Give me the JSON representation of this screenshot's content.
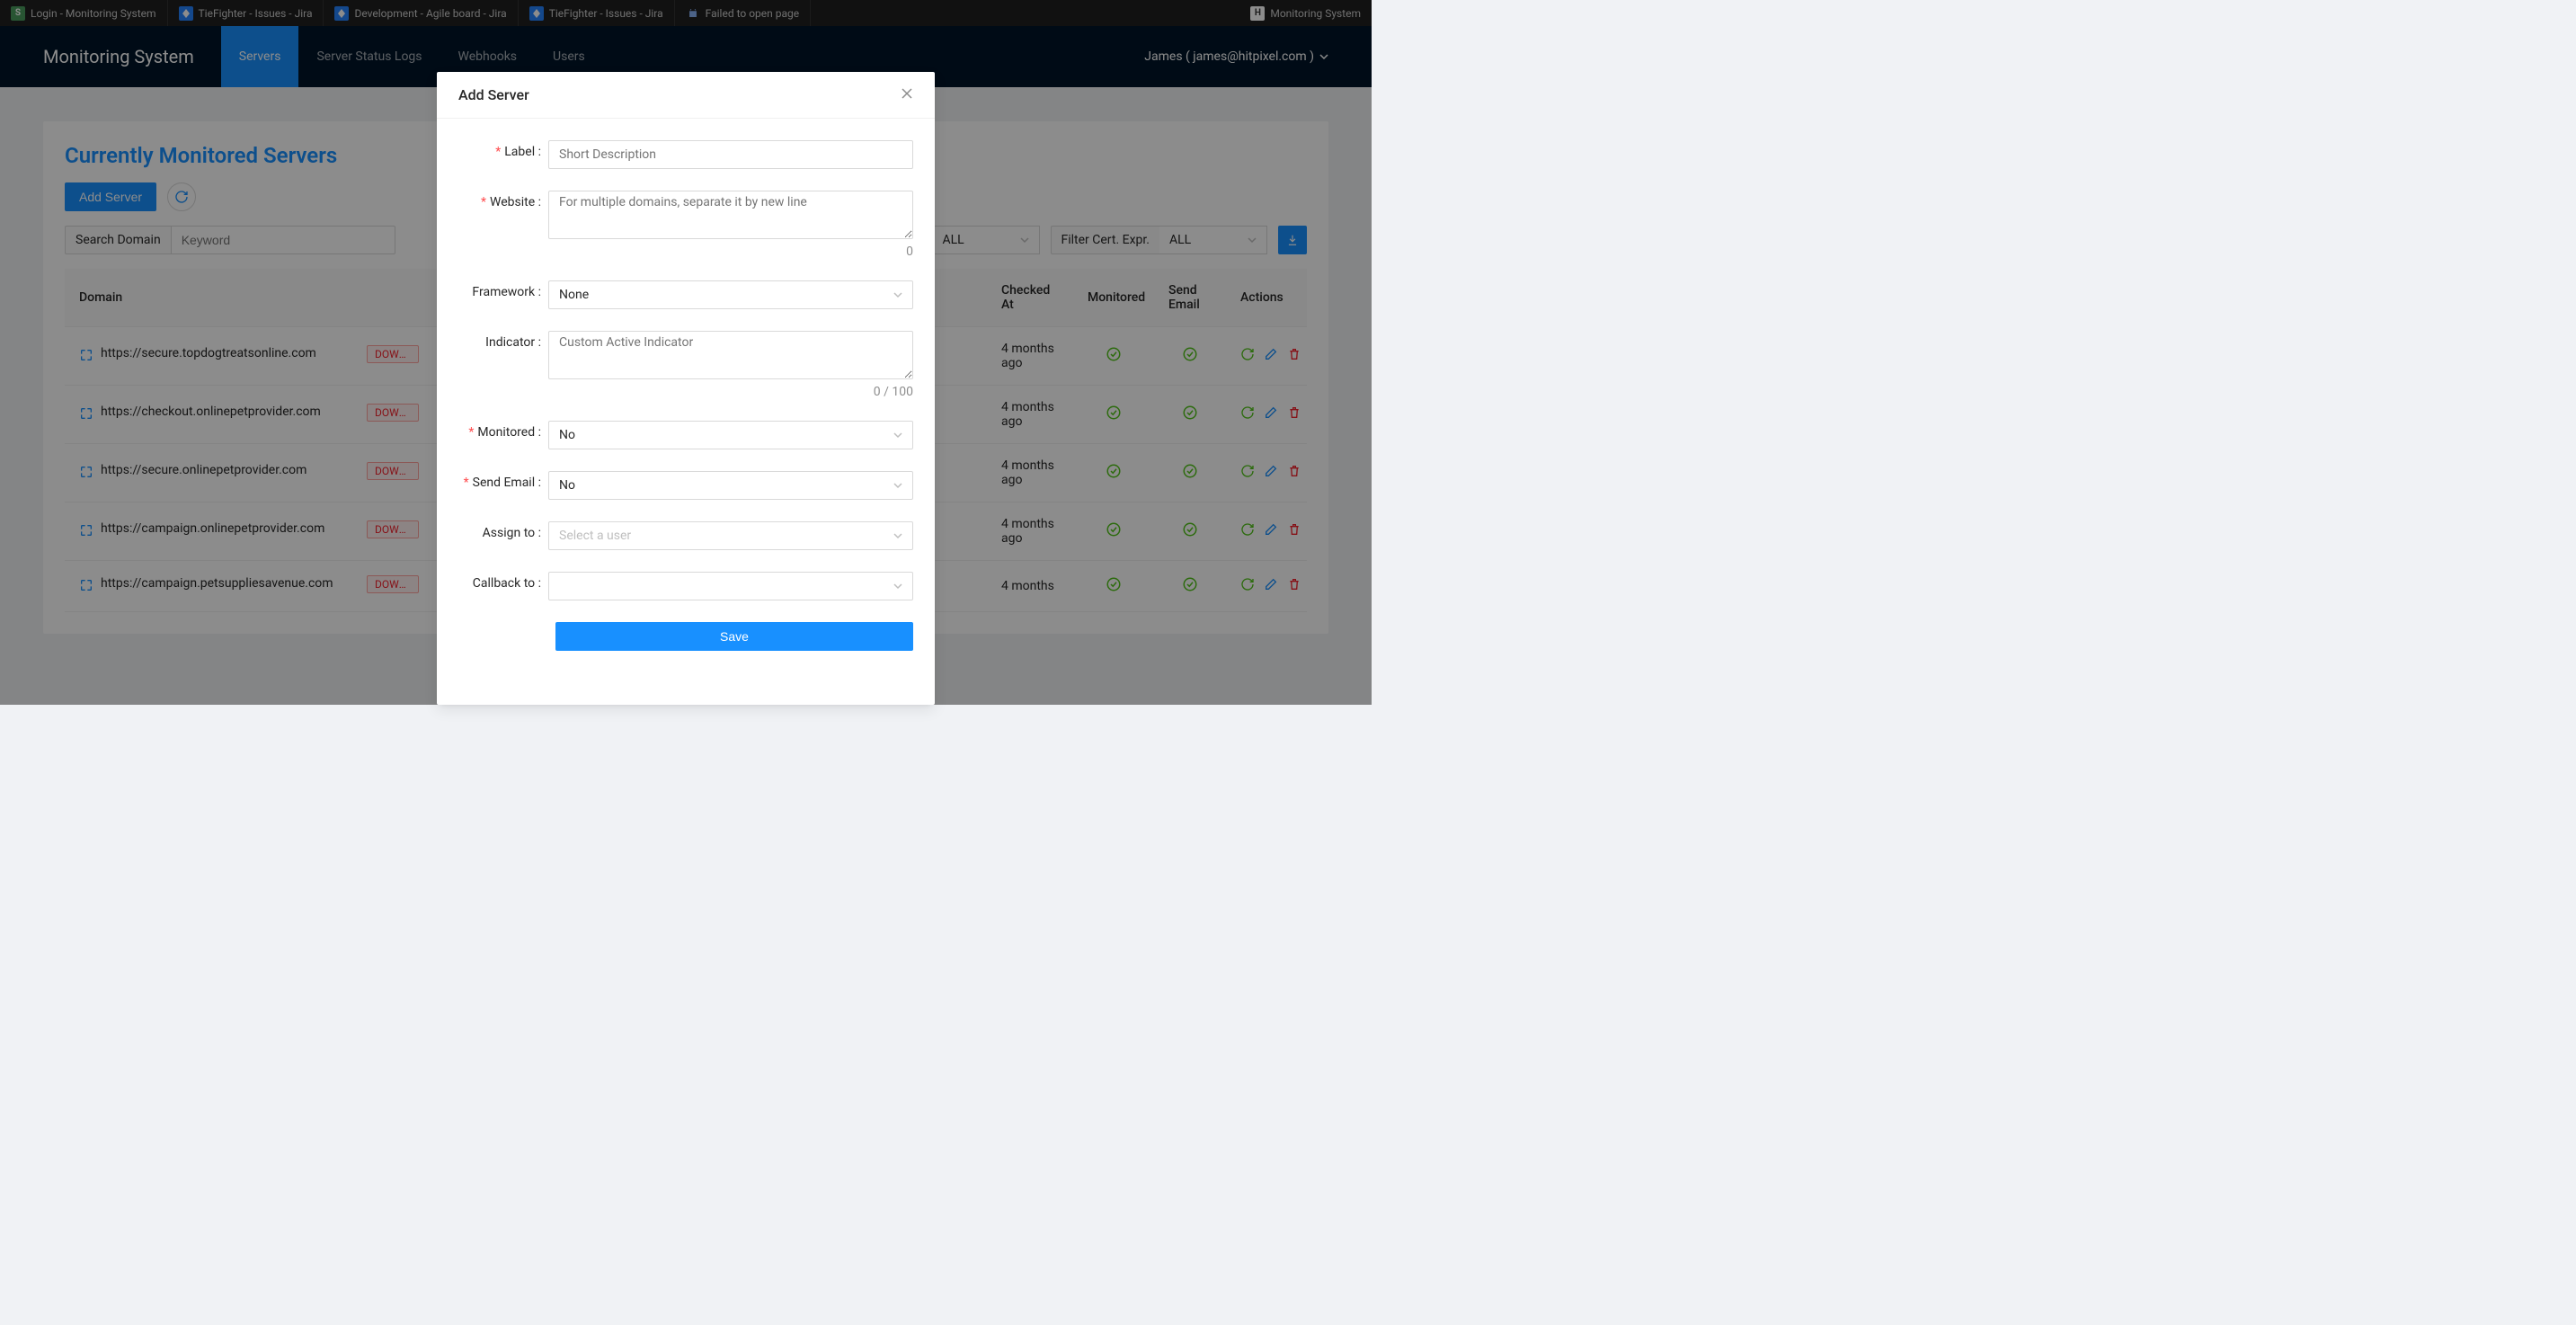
{
  "browserTabs": [
    {
      "icon": "S",
      "iconClass": "fav-s",
      "label": "Login - Monitoring System"
    },
    {
      "icon": "J",
      "iconClass": "fav-j",
      "label": "TieFighter - Issues - Jira"
    },
    {
      "icon": "J",
      "iconClass": "fav-j",
      "label": "Development - Agile board - Jira"
    },
    {
      "icon": "J",
      "iconClass": "fav-j",
      "label": "TieFighter - Issues - Jira"
    },
    {
      "icon": "A",
      "iconClass": "fav-a",
      "label": "Failed to open page"
    },
    {
      "icon": "H",
      "iconClass": "fav-h",
      "label": "Monitoring System"
    }
  ],
  "brand": "Monitoring System",
  "nav": [
    {
      "label": "Servers",
      "active": true
    },
    {
      "label": "Server Status Logs"
    },
    {
      "label": "Webhooks"
    },
    {
      "label": "Users"
    }
  ],
  "userMenu": "James ( james@hitpixel.com )",
  "pageTitle": "Currently Monitored Servers",
  "addServerBtn": "Add Server",
  "search": {
    "addonLabel": "Search Domain",
    "placeholder": "Keyword"
  },
  "filters": {
    "filterAllValue": "ALL",
    "certLabel": "Filter Cert. Expr.",
    "certValue": "ALL"
  },
  "columns": {
    "domain": "Domain",
    "checkedAt": "Checked At",
    "monitored": "Monitored",
    "sendEmail": "Send Email",
    "actions": "Actions"
  },
  "rows": [
    {
      "domain": "https://secure.topdogtreatsonline.com",
      "status": "DOWN (CO",
      "checkedAt": "4 months ago"
    },
    {
      "domain": "https://checkout.onlinepetprovider.com",
      "status": "DOWN (CO",
      "checkedAt": "4 months ago"
    },
    {
      "domain": "https://secure.onlinepetprovider.com",
      "status": "DOWN (CO",
      "checkedAt": "4 months ago"
    },
    {
      "domain": "https://campaign.onlinepetprovider.com",
      "status": "DOWN (CO",
      "checkedAt": "4 months ago"
    },
    {
      "domain": "https://campaign.petsuppliesavenue.com",
      "status": "DOWN (CO",
      "checkedAt": "4 months"
    }
  ],
  "modal": {
    "title": "Add Server",
    "labels": {
      "label": "Label",
      "website": "Website",
      "framework": "Framework",
      "indicator": "Indicator",
      "monitored": "Monitored",
      "sendEmail": "Send Email",
      "assignTo": "Assign to",
      "callbackTo": "Callback to"
    },
    "placeholders": {
      "label": "Short Description",
      "website": "For multiple domains, separate it by new line",
      "indicator": "Custom Active Indicator",
      "assignTo": "Select a user"
    },
    "values": {
      "framework": "None",
      "monitored": "No",
      "sendEmail": "No"
    },
    "counters": {
      "website": "0",
      "indicator": "0 / 100"
    },
    "saveBtn": "Save"
  }
}
